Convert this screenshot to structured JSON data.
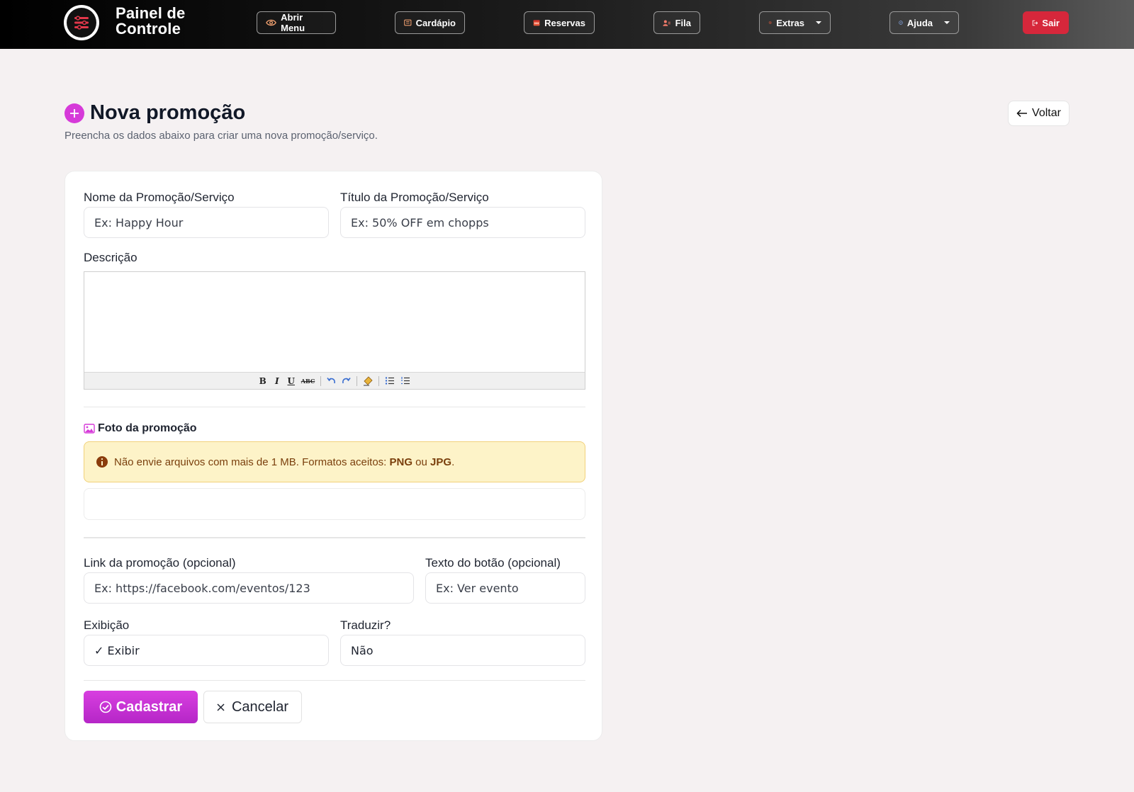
{
  "navbar": {
    "brand": "Painel de Controle",
    "items": [
      {
        "label": "Abrir Menu",
        "icon": "eye-icon"
      },
      {
        "label": "Cardápio",
        "icon": "menu-book-icon"
      },
      {
        "label": "Reservas",
        "icon": "calendar-icon"
      },
      {
        "label": "Fila",
        "icon": "users-icon"
      },
      {
        "label": "Extras",
        "icon": "gear-icon"
      },
      {
        "label": "Ajuda",
        "icon": "help-circle-icon"
      },
      {
        "label": "Sair",
        "icon": "logout-icon"
      }
    ]
  },
  "header": {
    "title": "Nova promoção",
    "subtitle": "Preencha os dados abaixo para criar uma nova promoção/serviço.",
    "back_label": "Voltar"
  },
  "form": {
    "name": {
      "label": "Nome da Promoção/Serviço",
      "placeholder": "Ex: Happy Hour"
    },
    "title": {
      "label": "Título da Promoção/Serviço",
      "placeholder": "Ex: 50% OFF em chopps"
    },
    "description": {
      "label": "Descrição"
    },
    "editor_toolbar": {
      "bold": "B",
      "italic": "I",
      "underline": "U",
      "strike": "ABC"
    },
    "photo": {
      "label": "Foto da promoção",
      "alert_text": "Não envie arquivos com mais de 1 MB. Formatos aceitos: ",
      "alert_png": "PNG",
      "alert_or": " ou ",
      "alert_jpg": "JPG",
      "alert_end": "."
    },
    "link": {
      "label": "Link da promoção (opcional)",
      "placeholder": "Ex: https://facebook.com/eventos/123"
    },
    "button_text": {
      "label": "Texto do botão (opcional)",
      "placeholder": "Ex: Ver evento"
    },
    "display": {
      "label": "Exibição",
      "value": "✓ Exibir"
    },
    "translate": {
      "label": "Traduzir?",
      "value": "Não"
    },
    "submit_label": "Cadastrar",
    "cancel_label": "Cancelar"
  },
  "colors": {
    "accent": "#d63ad9",
    "danger": "#d6273b",
    "alert_bg": "#fdf3c8"
  }
}
